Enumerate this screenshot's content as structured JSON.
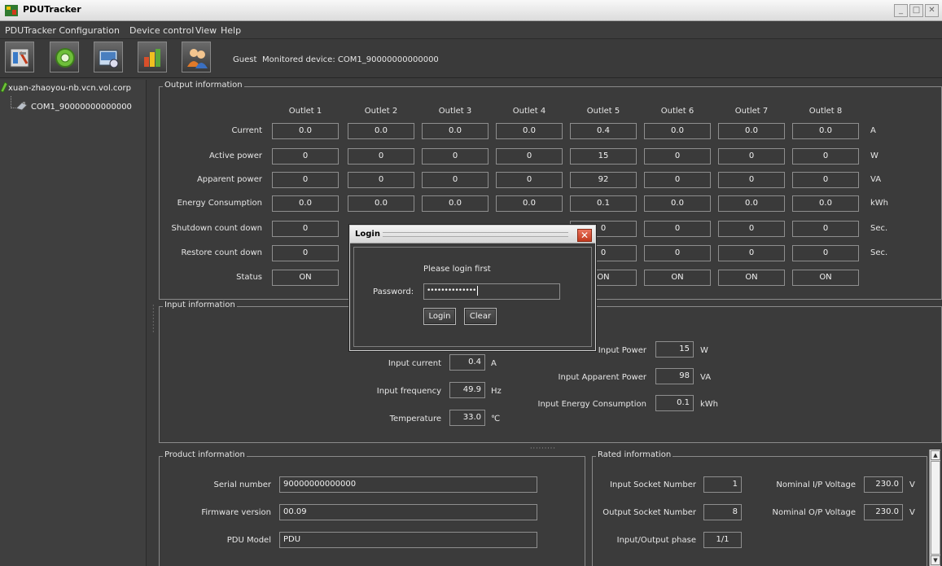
{
  "window": {
    "title": "PDUTracker"
  },
  "menu": [
    "PDUTracker Configuration",
    "Device control",
    "View",
    "Help"
  ],
  "toolbar": {
    "buttons": [
      "configuration-icon",
      "settings-gear-icon",
      "event-log-icon",
      "report-chart-icon",
      "user-login-icon"
    ],
    "user": "Guest",
    "monitored_label": "Monitored device:",
    "monitored_device": "COM1_90000000000000"
  },
  "tree": {
    "host": "xuan-zhaoyou-nb.vcn.vol.corp",
    "device": "COM1_90000000000000"
  },
  "output": {
    "title": "Output information",
    "outlets": [
      "Outlet 1",
      "Outlet 2",
      "Outlet 3",
      "Outlet 4",
      "Outlet 5",
      "Outlet 6",
      "Outlet 7",
      "Outlet 8"
    ],
    "rows": [
      {
        "label": "Current",
        "unit": "A",
        "values": [
          "0.0",
          "0.0",
          "0.0",
          "0.0",
          "0.4",
          "0.0",
          "0.0",
          "0.0"
        ]
      },
      {
        "label": "Active power",
        "unit": "W",
        "values": [
          "0",
          "0",
          "0",
          "0",
          "15",
          "0",
          "0",
          "0"
        ]
      },
      {
        "label": "Apparent  power",
        "unit": "VA",
        "values": [
          "0",
          "0",
          "0",
          "0",
          "92",
          "0",
          "0",
          "0"
        ]
      },
      {
        "label": "Energy Consumption",
        "unit": "kWh",
        "values": [
          "0.0",
          "0.0",
          "0.0",
          "0.0",
          "0.1",
          "0.0",
          "0.0",
          "0.0"
        ]
      },
      {
        "label": "Shutdown count down",
        "unit": "Sec.",
        "values": [
          "0",
          "",
          "",
          "",
          "0",
          "0",
          "0",
          "0"
        ]
      },
      {
        "label": "Restore count down",
        "unit": "Sec.",
        "values": [
          "0",
          "",
          "",
          "",
          "0",
          "0",
          "0",
          "0"
        ]
      },
      {
        "label": "Status",
        "unit": "",
        "values": [
          "ON",
          "",
          "",
          "",
          "ON",
          "ON",
          "ON",
          "ON"
        ]
      }
    ]
  },
  "input": {
    "title": "Input information",
    "current_label": "Input current",
    "current": "0.4",
    "current_unit": "A",
    "frequency_label": "Input frequency",
    "frequency": "49.9",
    "frequency_unit": "Hz",
    "temperature_label": "Temperature",
    "temperature": "33.0",
    "temperature_unit": "℃",
    "power_label": "Input Power",
    "power": "15",
    "power_unit": "W",
    "apparent_label": "Input Apparent Power",
    "apparent": "98",
    "apparent_unit": "VA",
    "energy_label": "Input Energy Consumption",
    "energy": "0.1",
    "energy_unit": "kWh"
  },
  "product": {
    "title": "Product information",
    "serial_label": "Serial number",
    "serial": "90000000000000",
    "firmware_label": "Firmware version",
    "firmware": "00.09",
    "model_label": "PDU Model",
    "model": "PDU"
  },
  "rated": {
    "title": "Rated information",
    "in_socket_label": "Input Socket Number",
    "in_socket": "1",
    "out_socket_label": "Output Socket Number",
    "out_socket": "8",
    "phase_label": "Input/Output phase",
    "phase": "1/1",
    "nom_in_label": "Nominal I/P Voltage",
    "nom_in": "230.0",
    "nom_in_unit": "V",
    "nom_out_label": "Nominal O/P Voltage",
    "nom_out": "230.0",
    "nom_out_unit": "V"
  },
  "dialog": {
    "title": "Login",
    "message": "Please login first",
    "password_label": "Password:",
    "password_value": "••••••••••••••",
    "login_label": "Login",
    "clear_label": "Clear"
  }
}
